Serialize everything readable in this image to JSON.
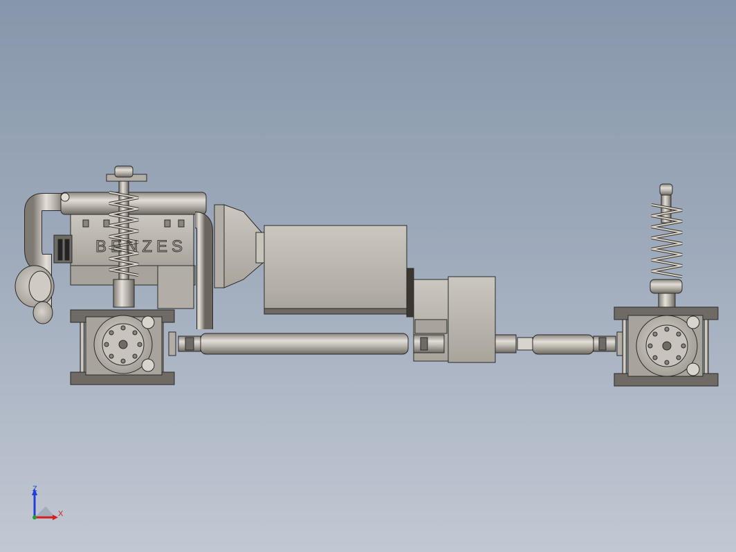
{
  "model": {
    "engraving_text": "BENZES"
  },
  "triad": {
    "z_label": "Z",
    "x_label": "X",
    "colors": {
      "z": "#1f3fd6",
      "x": "#d62020",
      "y": "#20a030"
    }
  },
  "colors": {
    "background_top": "#8797ab",
    "background_bottom": "#c2c8d3",
    "part_fill": "#b9b5ad",
    "part_dark": "#6f6b64",
    "outline": "#2a2a2a"
  }
}
